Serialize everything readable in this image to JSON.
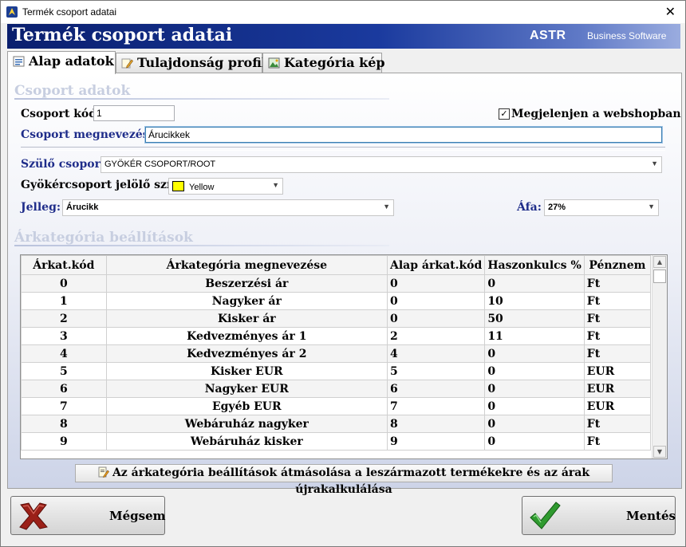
{
  "window": {
    "title": "Termék csoport adatai",
    "close_glyph": "✕"
  },
  "banner": {
    "heading": "Termék csoport adatai",
    "brand": "ASTR",
    "brand_suffix": "Business Software"
  },
  "tabs": [
    {
      "label": "Alap adatok",
      "icon": "form-icon",
      "active": true
    },
    {
      "label": "Tulajdonság profil",
      "icon": "edit-icon",
      "active": false
    },
    {
      "label": "Kategória kép",
      "icon": "picture-icon",
      "active": false
    }
  ],
  "group": {
    "section_title": "Csoport adatok",
    "code_label": "Csoport kód:",
    "code_value": "1",
    "webshop_label": "Megjelenjen a webshopban",
    "webshop_checked": true,
    "name_label": "Csoport megnevezése:",
    "name_value": "Árucikkek",
    "parent_label": "Szülő csoport:",
    "parent_value": "GYÖKÉR CSOPORT/ROOT",
    "rootcolor_label": "Gyökércsoport jelölő színe:",
    "rootcolor_value": "Yellow",
    "rootcolor_hex": "#ffff00",
    "type_label": "Jelleg:",
    "type_value": "Árucikk",
    "vat_label": "Áfa:",
    "vat_value": "27%"
  },
  "pricecat": {
    "section_title": "Árkategória beállítások",
    "columns": [
      "Árkat.kód",
      "Árkategória megnevezése",
      "Alap árkat.kód",
      "Haszonkulcs %",
      "Pénznem"
    ],
    "rows": [
      [
        "0",
        "Beszerzési ár",
        "0",
        "0",
        "Ft"
      ],
      [
        "1",
        "Nagyker ár",
        "0",
        "10",
        "Ft"
      ],
      [
        "2",
        "Kisker ár",
        "0",
        "50",
        "Ft"
      ],
      [
        "3",
        "Kedvezményes ár 1",
        "2",
        "11",
        "Ft"
      ],
      [
        "4",
        "Kedvezményes ár 2",
        "4",
        "0",
        "Ft"
      ],
      [
        "5",
        "Kisker EUR",
        "5",
        "0",
        "EUR"
      ],
      [
        "6",
        "Nagyker EUR",
        "6",
        "0",
        "EUR"
      ],
      [
        "7",
        "Egyéb EUR",
        "7",
        "0",
        "EUR"
      ],
      [
        "8",
        "Webáruház nagyker",
        "8",
        "0",
        "Ft"
      ],
      [
        "9",
        "Webáruház kisker",
        "9",
        "0",
        "Ft"
      ]
    ],
    "copy_button": "Az árkategória beállítások átmásolása a leszármazott termékekre és az árak újrakalkulálása"
  },
  "buttons": {
    "cancel": "Mégsem",
    "save": "Mentés"
  }
}
